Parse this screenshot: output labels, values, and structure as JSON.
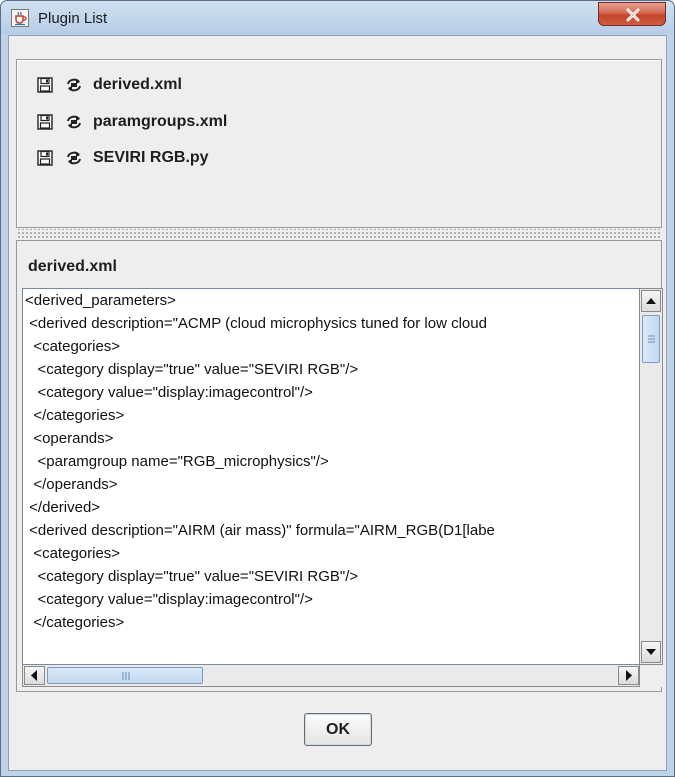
{
  "window": {
    "title": "Plugin List"
  },
  "plugins": [
    {
      "name": "derived.xml"
    },
    {
      "name": "paramgroups.xml"
    },
    {
      "name": "SEVIRI RGB.py"
    }
  ],
  "editor": {
    "file_title": "derived.xml",
    "lines": [
      "<derived_parameters>",
      " <derived description=\"ACMP (cloud microphysics tuned for low cloud",
      "  <categories>",
      "   <category display=\"true\" value=\"SEVIRI RGB\"/>",
      "   <category value=\"display:imagecontrol\"/>",
      "  </categories>",
      "  <operands>",
      "   <paramgroup name=\"RGB_microphysics\"/>",
      "  </operands>",
      " </derived>",
      " <derived description=\"AIRM (air mass)\" formula=\"AIRM_RGB(D1[labe",
      "  <categories>",
      "   <category display=\"true\" value=\"SEVIRI RGB\"/>",
      "   <category value=\"display:imagecontrol\"/>",
      "  </categories>"
    ],
    "vertical_scroll_position": 0.05,
    "horizontal_scroll_position": 0.0
  },
  "buttons": {
    "ok_label": "OK"
  },
  "icons": {
    "app": "java-cup-icon",
    "close": "close-icon",
    "save": "floppy-disk-icon",
    "reload": "reload-arrows-icon"
  },
  "colors": {
    "titlebar": "#bfd3e8",
    "close_button": "#c4432a",
    "client_background": "#eeeeee",
    "scroll_thumb": "#c2d8ef"
  }
}
